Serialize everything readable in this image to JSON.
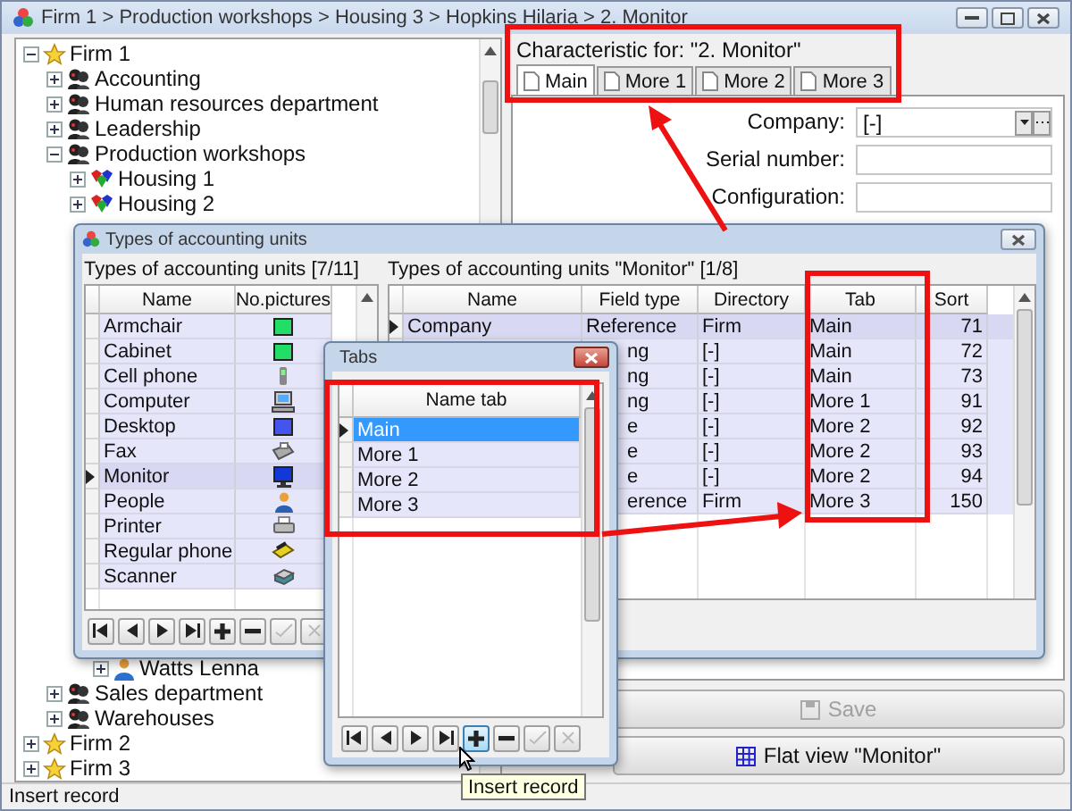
{
  "window": {
    "title": "Firm 1 > Production workshops > Housing 3 > Hopkins Hilaria > 2. Monitor"
  },
  "tree": [
    {
      "label": "Firm 1",
      "kind": "firm",
      "expanded": true,
      "children": [
        {
          "label": "Accounting",
          "kind": "department",
          "expanded": false
        },
        {
          "label": "Human resources department",
          "kind": "department",
          "expanded": false
        },
        {
          "label": "Leadership",
          "kind": "department",
          "expanded": false
        },
        {
          "label": "Production workshops",
          "kind": "department",
          "expanded": true,
          "children": [
            {
              "label": "Housing 1",
              "kind": "housing",
              "expanded": false
            },
            {
              "label": "Housing 2",
              "kind": "housing",
              "expanded": false
            },
            {
              "children": [
                {
                  "label": "Watts Lenna",
                  "kind": "person",
                  "expanded": false
                }
              ]
            }
          ]
        },
        {
          "label": "Sales department",
          "kind": "department",
          "expanded": false
        },
        {
          "label": "Warehouses",
          "kind": "department",
          "expanded": false
        }
      ]
    },
    {
      "label": "Firm 2",
      "kind": "firm",
      "expanded": false
    },
    {
      "label": "Firm 3",
      "kind": "firm",
      "expanded": false
    }
  ],
  "details": {
    "title": "Characteristic for: \"2. Monitor\"",
    "tabs": [
      {
        "label": "Main",
        "selected": true
      },
      {
        "label": "More 1",
        "selected": false
      },
      {
        "label": "More 2",
        "selected": false
      },
      {
        "label": "More 3",
        "selected": false
      }
    ],
    "fields": [
      {
        "label": "Company:",
        "kind": "reference",
        "value": "[-]"
      },
      {
        "label": "Serial number:",
        "kind": "text"
      },
      {
        "label": "Configuration:",
        "kind": "text"
      }
    ],
    "buttons": [
      {
        "label": "Save",
        "kind": "save",
        "disabled": true
      },
      {
        "label": "Flat view \"Monitor\"",
        "kind": "grid",
        "disabled": false
      }
    ]
  },
  "units_window": {
    "title": "Types of accounting units",
    "types": {
      "title": "Types of accounting units [7/11]",
      "columns": [
        "Name",
        "No.pictures"
      ],
      "rows": [
        {
          "name": "Armchair",
          "kind": "swatch",
          "color": "#22dd66",
          "selected": false
        },
        {
          "name": "Cabinet",
          "kind": "swatch",
          "color": "#22dd66",
          "selected": false
        },
        {
          "name": "Cell phone",
          "kind": "cellphone",
          "selected": false
        },
        {
          "name": "Computer",
          "kind": "computer",
          "selected": false
        },
        {
          "name": "Desktop",
          "kind": "swatch",
          "color": "#4455ee",
          "selected": false
        },
        {
          "name": "Fax",
          "kind": "fax",
          "selected": false
        },
        {
          "name": "Monitor",
          "kind": "monitor",
          "selected": true
        },
        {
          "name": "People",
          "kind": "people",
          "selected": false
        },
        {
          "name": "Printer",
          "kind": "printer",
          "selected": false
        },
        {
          "name": "Regular phone",
          "kind": "phone",
          "selected": false
        },
        {
          "name": "Scanner",
          "kind": "scanner",
          "selected": false
        }
      ],
      "nav": [
        {
          "kind": "first",
          "disabled": false,
          "hovered": false
        },
        {
          "kind": "prev",
          "disabled": false,
          "hovered": false
        },
        {
          "kind": "next",
          "disabled": false,
          "hovered": false
        },
        {
          "kind": "last",
          "disabled": false,
          "hovered": false
        },
        {
          "kind": "add",
          "disabled": false,
          "hovered": false
        },
        {
          "kind": "delete",
          "disabled": false,
          "hovered": false
        },
        {
          "kind": "post",
          "disabled": true,
          "hovered": false
        },
        {
          "kind": "cancel",
          "disabled": true,
          "hovered": false
        }
      ]
    },
    "fields": {
      "title": "Types of accounting units \"Monitor\" [1/8]",
      "columns": [
        "Name",
        "Field type",
        "Directory",
        "Tab",
        "Sort"
      ],
      "rows": [
        {
          "name": "Company",
          "field_type": "Reference",
          "field_type_cut": false,
          "directory": "Firm",
          "tab": "Main",
          "sort": "71",
          "selected": true
        },
        {
          "field_type": "ng",
          "field_type_cut": true,
          "directory": "[-]",
          "tab": "Main",
          "sort": "72",
          "selected": false
        },
        {
          "field_type": "ng",
          "field_type_cut": true,
          "directory": "[-]",
          "tab": "Main",
          "sort": "73",
          "selected": false
        },
        {
          "field_type": "ng",
          "field_type_cut": true,
          "directory": "[-]",
          "tab": "More 1",
          "sort": "91",
          "selected": false
        },
        {
          "field_type": "e",
          "field_type_cut": true,
          "directory": "[-]",
          "tab": "More 2",
          "sort": "92",
          "selected": false
        },
        {
          "field_type": "e",
          "field_type_cut": true,
          "directory": "[-]",
          "tab": "More 2",
          "sort": "93",
          "selected": false
        },
        {
          "field_type": "e",
          "field_type_cut": true,
          "directory": "[-]",
          "tab": "More 2",
          "sort": "94",
          "selected": false
        },
        {
          "field_type": "erence",
          "field_type_cut": true,
          "directory": "Firm",
          "tab": "More 3",
          "sort": "150",
          "selected": false
        }
      ]
    }
  },
  "tabs_dialog": {
    "title": "Tabs",
    "columns": [
      "Name tab"
    ],
    "rows": [
      {
        "name": "Main",
        "selected": true
      },
      {
        "name": "More 1",
        "selected": false
      },
      {
        "name": "More 2",
        "selected": false
      },
      {
        "name": "More 3",
        "selected": false
      }
    ],
    "nav": [
      {
        "kind": "first",
        "disabled": false,
        "hovered": false
      },
      {
        "kind": "prev",
        "disabled": false,
        "hovered": false
      },
      {
        "kind": "next",
        "disabled": false,
        "hovered": false
      },
      {
        "kind": "last",
        "disabled": false,
        "hovered": false
      },
      {
        "kind": "add",
        "disabled": false,
        "hovered": true
      },
      {
        "kind": "delete",
        "disabled": false,
        "hovered": false
      },
      {
        "kind": "post",
        "disabled": true,
        "hovered": false
      },
      {
        "kind": "cancel",
        "disabled": true,
        "hovered": false
      }
    ]
  },
  "tooltip": "Insert record",
  "status_bar": "Insert record"
}
